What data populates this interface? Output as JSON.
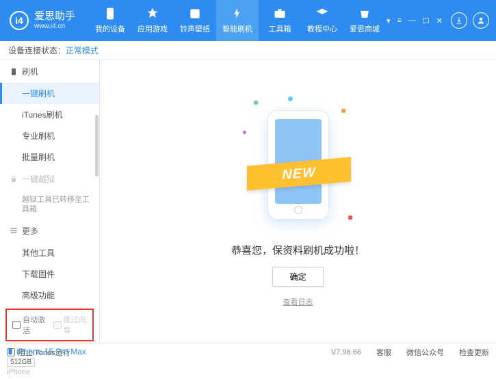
{
  "header": {
    "logo_text": "爱思助手",
    "logo_sub": "www.i4.cn",
    "nav": [
      {
        "label": "我的设备"
      },
      {
        "label": "应用游戏"
      },
      {
        "label": "铃声壁纸"
      },
      {
        "label": "智能刷机"
      },
      {
        "label": "工具箱"
      },
      {
        "label": "教程中心"
      },
      {
        "label": "爱思商城"
      }
    ]
  },
  "status": {
    "prefix": "设备连接状态：",
    "mode": "正常模式"
  },
  "sidebar": {
    "flash_section": "刷机",
    "items_flash": [
      {
        "label": "一键刷机"
      },
      {
        "label": "iTunes刷机"
      },
      {
        "label": "专业刷机"
      },
      {
        "label": "批量刷机"
      }
    ],
    "jailbreak_section": "一键越狱",
    "jailbreak_note": "越狱工具已转移至工具箱",
    "more_section": "更多",
    "items_more": [
      {
        "label": "其他工具"
      },
      {
        "label": "下载固件"
      },
      {
        "label": "高级功能"
      }
    ],
    "checkbox_auto": "自动激活",
    "checkbox_skip": "跳过向导",
    "device": {
      "name": "iPhone 15 Pro Max",
      "storage": "512GB",
      "type": "iPhone"
    }
  },
  "main": {
    "ribbon": "NEW",
    "success": "恭喜您，保资料刷机成功啦！",
    "ok": "确定",
    "log": "查看日志"
  },
  "footer": {
    "block_itunes": "阻止iTunes运行",
    "version": "V7.98.66",
    "links": [
      "客服",
      "微信公众号",
      "检查更新"
    ]
  }
}
